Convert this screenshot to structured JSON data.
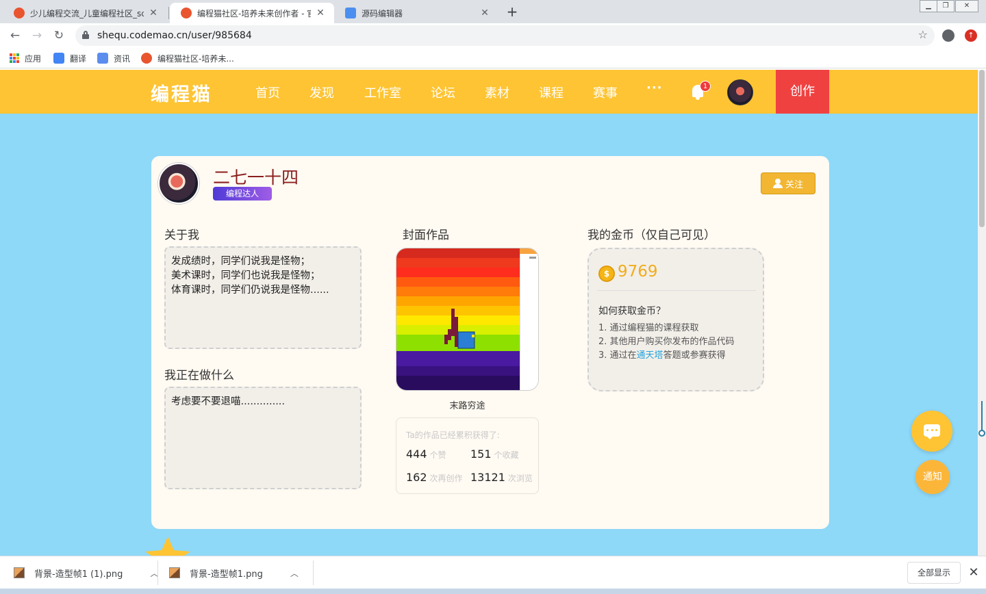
{
  "browser": {
    "tabs": [
      {
        "title": "少儿编程交流_儿童编程社区_scr",
        "active": false
      },
      {
        "title": "编程猫社区-培养未来创作者 - 官",
        "active": true
      },
      {
        "title": "源码编辑器",
        "active": false
      }
    ],
    "url": "shequ.codemao.cn/user/985684",
    "bookmarks": [
      "应用",
      "翻译",
      "资讯",
      "编程猫社区-培养未..."
    ]
  },
  "site": {
    "logo": "编程猫",
    "nav": [
      "首页",
      "发现",
      "工作室",
      "论坛",
      "素材",
      "课程",
      "赛事"
    ],
    "more": "···",
    "notification_count": "1",
    "create_label": "创作"
  },
  "profile": {
    "username": "二七一十四",
    "level": "编程达人",
    "follow_label": "关注",
    "about_title": "关于我",
    "about_lines": [
      "发成绩时，同学们说我是怪物；",
      "美术课时，同学们也说我是怪物；",
      "体育课时，同学们仍说我是怪物......"
    ],
    "doing_title": "我正在做什么",
    "doing_text": "考虑要不要退喵..............",
    "cover_title": "封面作品",
    "cover_name": "末路穷途",
    "stats_heading": "Ta的作品已经累积获得了:",
    "stats": {
      "likes": {
        "value": "444",
        "unit": "个赞"
      },
      "favorites": {
        "value": "151",
        "unit": "个收藏"
      },
      "remixes": {
        "value": "162",
        "unit": "次再创作"
      },
      "views": {
        "value": "13121",
        "unit": "次浏览"
      }
    },
    "coins_title": "我的金币（仅自己可见）",
    "coins": "9769",
    "coin_symbol": "$",
    "howto_title": "如何获取金币？",
    "steps": {
      "s1": "1. 通过编程猫的课程获取",
      "s2": "2. 其他用户购买你发布的作品代码",
      "s3_pre": "3. 通过在",
      "s3_link": "通天塔",
      "s3_post": "答题或参赛获得"
    }
  },
  "floating": {
    "notify_label": "通知"
  },
  "downloads": {
    "items": [
      "背景-造型帧1 (1).png",
      "背景-造型帧1.png"
    ],
    "show_all": "全部显示"
  },
  "colors": {
    "nav_bg": "#fec433",
    "create_bg": "#f04141",
    "page_bg": "#8ed8f8",
    "card_bg": "#fffaf2",
    "username": "#8b1f1f",
    "coin": "#f2ac1c",
    "link": "#27a4de"
  }
}
